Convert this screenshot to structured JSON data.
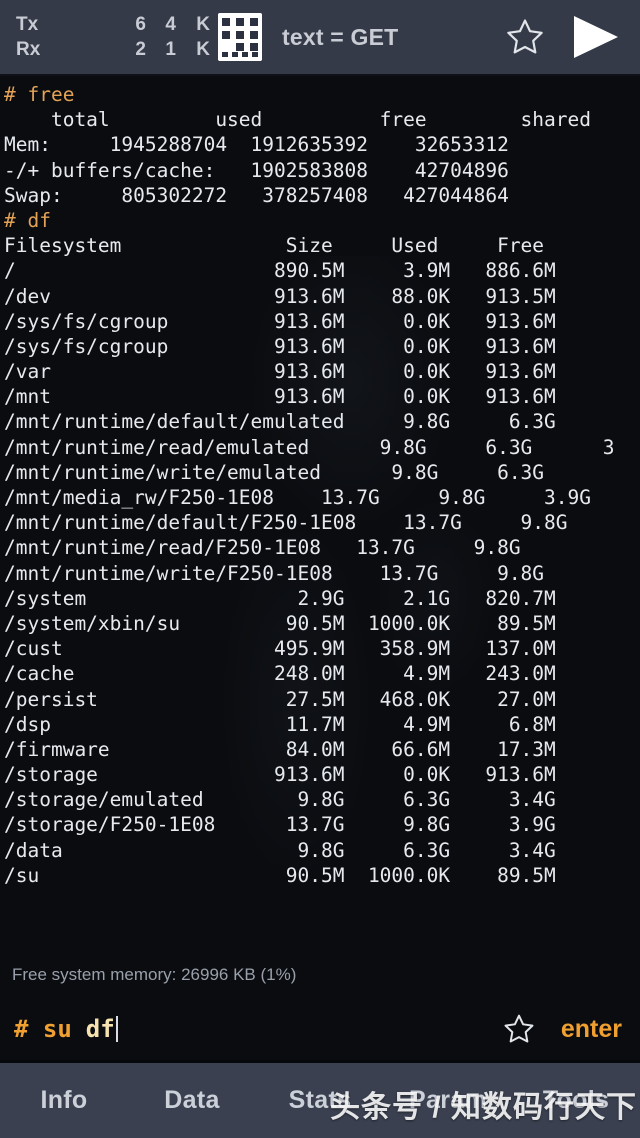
{
  "topbar": {
    "tx_label": "Tx",
    "rx_label": "Rx",
    "tx_count": "6",
    "rx_count": "2",
    "tx_rate": "4",
    "rx_rate": "1",
    "tx_unit": "K",
    "rx_unit": "K",
    "matrix_icon": "matrix-grid-icon",
    "mode_label": "text = GET",
    "star_icon": "star-outline-icon",
    "play_icon": "play-icon"
  },
  "terminal": {
    "lines": [
      {
        "prompt": "# ",
        "text": "free"
      },
      {
        "prompt": "",
        "text": "    total         used          free        shared       bu"
      },
      {
        "prompt": "",
        "text": "Mem:     1945288704  1912635392    32653312       "
      },
      {
        "prompt": "",
        "text": "-/+ buffers/cache:   1902583808    42704896"
      },
      {
        "prompt": "",
        "text": "Swap:     805302272   378257408   427044864"
      },
      {
        "prompt": "# ",
        "text": "df"
      },
      {
        "prompt": "",
        "text": "Filesystem              Size     Used     Free    "
      },
      {
        "prompt": "",
        "text": "/                      890.5M     3.9M   886.6M   "
      },
      {
        "prompt": "",
        "text": "/dev                   913.6M    88.0K   913.5M   "
      },
      {
        "prompt": "",
        "text": "/sys/fs/cgroup         913.6M     0.0K   913.6M   "
      },
      {
        "prompt": "",
        "text": "/sys/fs/cgroup         913.6M     0.0K   913.6M   "
      },
      {
        "prompt": "",
        "text": "/var                   913.6M     0.0K   913.6M   "
      },
      {
        "prompt": "",
        "text": "/mnt                   913.6M     0.0K   913.6M   "
      },
      {
        "prompt": "",
        "text": "/mnt/runtime/default/emulated     9.8G     6.3G"
      },
      {
        "prompt": "",
        "text": "/mnt/runtime/read/emulated      9.8G     6.3G      3"
      },
      {
        "prompt": "",
        "text": "/mnt/runtime/write/emulated      9.8G     6.3G"
      },
      {
        "prompt": "",
        "text": "/mnt/media_rw/F250-1E08    13.7G     9.8G     3.9G"
      },
      {
        "prompt": "",
        "text": "/mnt/runtime/default/F250-1E08    13.7G     9.8G"
      },
      {
        "prompt": "",
        "text": "/mnt/runtime/read/F250-1E08   13.7G     9.8G"
      },
      {
        "prompt": "",
        "text": "/mnt/runtime/write/F250-1E08    13.7G     9.8G"
      },
      {
        "prompt": "",
        "text": "/system                  2.9G     2.1G   820.7M   "
      },
      {
        "prompt": "",
        "text": "/system/xbin/su         90.5M  1000.0K    89.5M   "
      },
      {
        "prompt": "",
        "text": "/cust                  495.9M   358.9M   137.0M   "
      },
      {
        "prompt": "",
        "text": "/cache                 248.0M     4.9M   243.0M   "
      },
      {
        "prompt": "",
        "text": "/persist                27.5M   468.0K    27.0M   "
      },
      {
        "prompt": "",
        "text": "/dsp                    11.7M     4.9M     6.8M   "
      },
      {
        "prompt": "",
        "text": "/firmware               84.0M    66.6M    17.3M   "
      },
      {
        "prompt": "",
        "text": "/storage               913.6M     0.0K   913.6M   "
      },
      {
        "prompt": "",
        "text": "/storage/emulated        9.8G     6.3G     3.4G   "
      },
      {
        "prompt": "",
        "text": "/storage/F250-1E08      13.7G     9.8G     3.9G   "
      },
      {
        "prompt": "",
        "text": "/data                    9.8G     6.3G     3.4G   "
      },
      {
        "prompt": "",
        "text": "/su                     90.5M  1000.0K    89.5M   "
      }
    ]
  },
  "status": {
    "text": "Free system memory: 26996 KB  (1%)"
  },
  "input": {
    "prompt": "# su",
    "value": "df",
    "star_icon": "star-outline-icon",
    "enter_label": "enter"
  },
  "tabs": [
    {
      "label": "Info"
    },
    {
      "label": "Data"
    },
    {
      "label": "Stats"
    },
    {
      "label": "Param"
    },
    {
      "label": "Tools"
    }
  ],
  "watermark": {
    "text": "头条号 / 知数码行天下"
  },
  "colors": {
    "topbar_bg": "#343a48",
    "terminal_bg": "#0a0c10",
    "terminal_fg": "#e6e9ee",
    "prompt_orange": "#e3a256",
    "input_orange": "#f0a030",
    "input_value": "#f7e3b0",
    "tabbar_bg": "#3a4050",
    "status_fg": "#9aa0ab"
  }
}
